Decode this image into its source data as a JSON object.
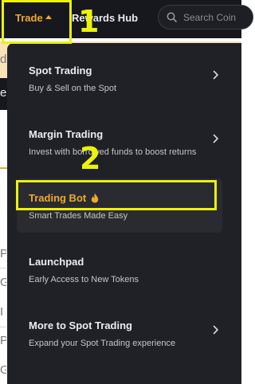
{
  "topnav": {
    "trade_label": "Trade",
    "rewards_label": "Rewards Hub",
    "search_placeholder": "Search Coin"
  },
  "background_fragments": {
    "banner_char": "d",
    "dark_char": "e",
    "row_chars": [
      "P",
      "G",
      "I",
      "P",
      "G"
    ]
  },
  "menu": {
    "items": [
      {
        "title": "Spot Trading",
        "description": "Buy & Sell on the Spot",
        "has_chevron": true
      },
      {
        "title": "Margin Trading",
        "description": "Invest with borrowed funds to boost returns",
        "has_chevron": true
      },
      {
        "title": "Trading Bot",
        "description": "Smart Trades Made Easy",
        "has_chevron": false,
        "badge_icon": "flame-icon",
        "active": true
      },
      {
        "title": "Launchpad",
        "description": "Early Access to New Tokens",
        "has_chevron": false
      },
      {
        "title": "More to Spot Trading",
        "description": "Expand your Spot Trading experience",
        "has_chevron": true
      }
    ]
  },
  "annotations": {
    "step1": "1",
    "step2": "2"
  },
  "colors": {
    "accent": "#f0a92a",
    "highlight": "#ecf20b",
    "menu_bg": "#202127",
    "topbar_bg": "#17181e"
  }
}
